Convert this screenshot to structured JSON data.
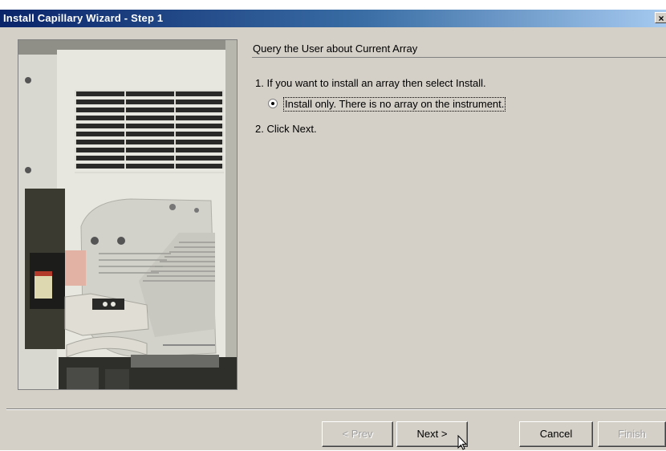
{
  "window": {
    "title": "Install Capillary Wizard - Step 1",
    "close_glyph": "×"
  },
  "panel": {
    "heading": "Query the User about Current Array",
    "step1": "1. If you want to  install an array then select Install.",
    "option_label": "Install only. There is no array on the instrument.",
    "option_selected": true,
    "step2": "2. Click Next."
  },
  "buttons": {
    "prev": {
      "label": "< Prev",
      "enabled": false
    },
    "next": {
      "label": "Next >",
      "enabled": true
    },
    "cancel": {
      "label": "Cancel",
      "enabled": true
    },
    "finish": {
      "label": "Finish",
      "enabled": false
    }
  },
  "colors": {
    "titlebar_start": "#0a246a",
    "titlebar_end": "#a6caf0",
    "dialog_bg": "#d4d0c8",
    "disabled_text": "#a0a0a0"
  },
  "icons": {
    "close": "close-icon",
    "radio": "radio-selected-icon",
    "cursor": "mouse-pointer-icon"
  }
}
